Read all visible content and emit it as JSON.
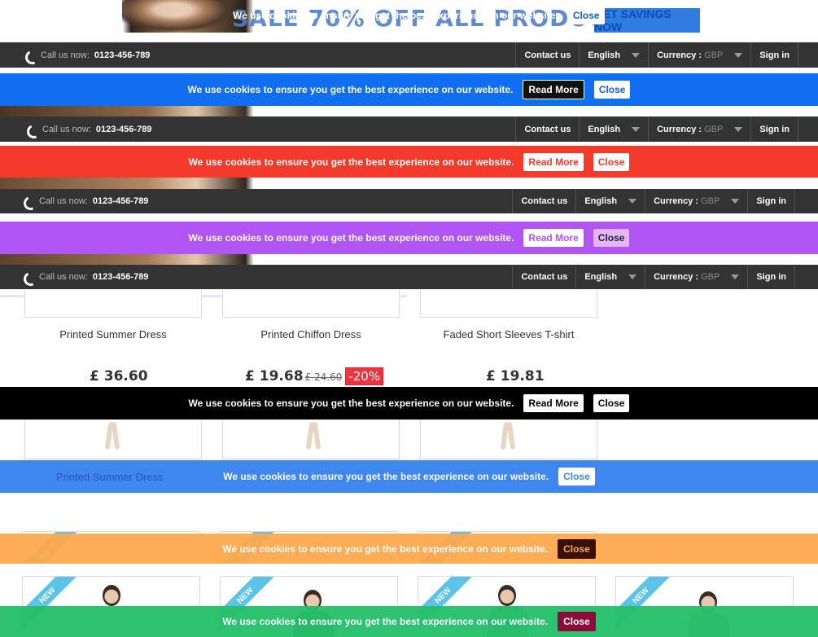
{
  "hero": {
    "promo_text": "SALE 70% OFF ALL PRODUCTS",
    "promo_button": "GET SAVINGS NOW"
  },
  "nav": {
    "call_label": "Call us now:",
    "phone": "0123-456-789",
    "contact": "Contact us",
    "language": "English",
    "currency_label": "Currency :",
    "currency_value": "GBP",
    "sign_in": "Sign in"
  },
  "cookie": {
    "message": "We use cookies to ensure you get the best experience on our website.",
    "read_more": "Read More",
    "close": "Close"
  },
  "products": [
    {
      "name": "Printed Summer Dress",
      "price": "£ 36.60"
    },
    {
      "name": "Printed Chiffon Dress",
      "price": "£ 19.68",
      "old_price": "£ 24.60",
      "discount": "-20%"
    },
    {
      "name": "Faded Short Sleeves T-shirt",
      "price": "£ 19.81"
    }
  ],
  "repeat_name": "Printed Summer Dress",
  "ribbon": "NEW",
  "colors": {
    "nav_bg": "#333333",
    "cookie_blue": "#0f6ff0",
    "cookie_red": "#f43a2b",
    "cookie_purple": "#b154f4",
    "cookie_black": "#000000",
    "cookie_lightblue": "#3e87ee",
    "cookie_orange": "#fda94c",
    "cookie_green": "#26c06a",
    "ribbon": "#5bc2e8",
    "discount": "#f13340"
  }
}
